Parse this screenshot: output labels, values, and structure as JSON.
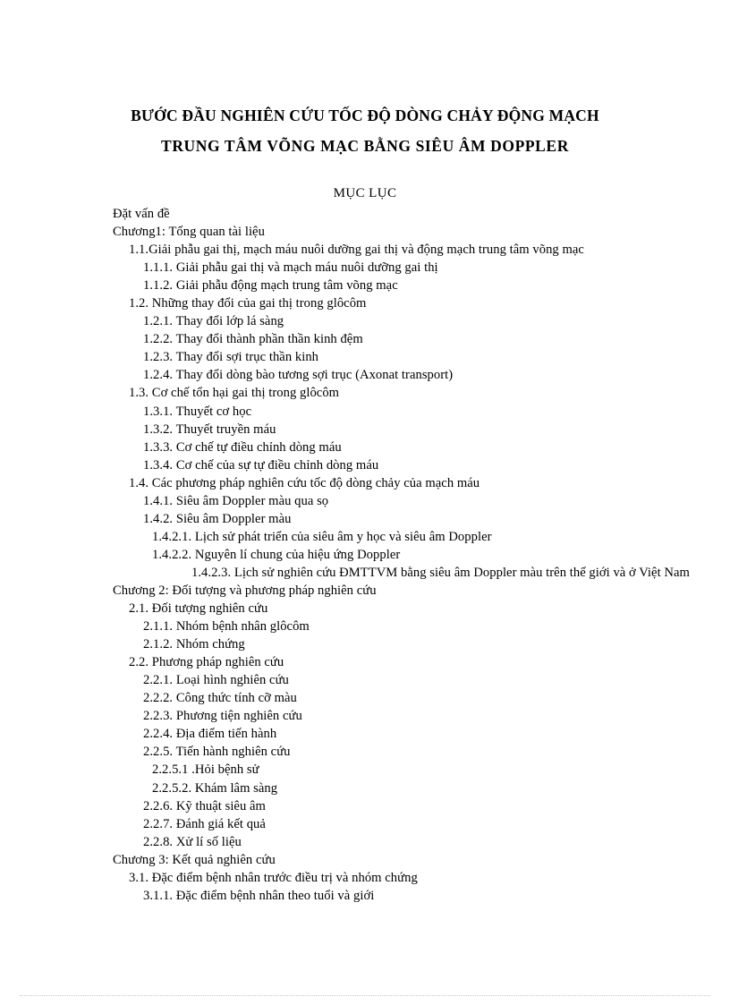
{
  "document": {
    "title_lines": [
      "BƯỚC ĐẦU NGHIÊN CỨU TỐC ĐỘ DÒNG CHẢY ĐỘNG MẠCH",
      "TRUNG TÂM  VÕNG MẠC BẰNG SIÊU ÂM  DOPPLER"
    ],
    "toc_heading": "MỤC LỤC",
    "toc_entries": [
      {
        "level": 0,
        "text": "Đặt vấn  đề"
      },
      {
        "level": 0,
        "text": "Chương1:  Tổng quan tài liệu"
      },
      {
        "level": 1,
        "text": "1.1.Giải  phẫu  gai thị,  mạch  máu  nuôi  dưỡng  gai thị  và động  mạch  trung  tâm võng  mạc"
      },
      {
        "level": 2,
        "text": "1.1.1. Giải  phẫu gai thị và mạch máu  nuôi  dưỡng gai thị"
      },
      {
        "level": 2,
        "text": "1.1.2. Giải  phẫu động mạch  trung tâm võng  mạc"
      },
      {
        "level": 1,
        "text": "1.2. Những  thay  đổi của gai thị  trong glôcôm"
      },
      {
        "level": 2,
        "text": "1.2.1. Thay  đổi lớp lá sàng"
      },
      {
        "level": 2,
        "text": "1.2.2. Thay  đổi thành  phần  thần  kinh  đệm"
      },
      {
        "level": 2,
        "text": "1.2.3. Thay  đổi sợi trục thần kinh"
      },
      {
        "level": 2,
        "text": "1.2.4. Thay  đổi dòng bào tương sợi  trục (Axonat  transport)"
      },
      {
        "level": 1,
        "text": "1.3. Cơ chế tổn hại  gai thị  trong  glôcôm"
      },
      {
        "level": 2,
        "text": "1.3.1. Thuyết  cơ học"
      },
      {
        "level": 2,
        "text": "1.3.2. Thuyết  truyền  máu"
      },
      {
        "level": 2,
        "text": "1.3.3. Cơ chế tự điều  chỉnh   dòng máu"
      },
      {
        "level": 2,
        "text": "1.3.4. Cơ chế của sự tự điều  chỉnh   dòng máu"
      },
      {
        "level": 1,
        "text": "1.4. Các phương  pháp nghiên   cứu tốc độ dòng  chảy  của mạch máu"
      },
      {
        "level": 2,
        "text": "1.4.1. Siêu  âm Doppler  màu qua sọ"
      },
      {
        "level": 2,
        "text": "1.4.2. Siêu  âm Doppler  màu"
      },
      {
        "level": 3,
        "text": "1.4.2.1. Lịch  sử phát triển  của siêu  âm y học và siêu  âm Doppler"
      },
      {
        "level": 3,
        "text": "1.4.2.2. Nguyên  lí chung  của hiệu  ứng Doppler"
      },
      {
        "level": 3,
        "wrap": true,
        "text": "1.4.2.3. Lịch  sử nghiên   cứu ĐMTTVM  bằng  siêu  âm Doppler  màu trên thế  giới  và ở Việt Nam"
      },
      {
        "level": 0,
        "text": "Chương 2:  Đối tượng và phương  pháp nghiên   cứu"
      },
      {
        "level": 1,
        "text": "2.1. Đối tượng nghiên   cứu"
      },
      {
        "level": 2,
        "text": "2.1.1. Nhóm bệnh nhân  glôcôm"
      },
      {
        "level": 2,
        "text": "2.1.2. Nhóm chứng"
      },
      {
        "level": 1,
        "text": "2.2. Phương  pháp nghiên   cứu"
      },
      {
        "level": 2,
        "text": "2.2.1. Loại hình  nghiên   cứu"
      },
      {
        "level": 2,
        "text": "2.2.2. Công thức tính  cỡ màu"
      },
      {
        "level": 2,
        "text": "2.2.3. Phương  tiện nghiên   cứu"
      },
      {
        "level": 2,
        "text": "2.2.4. Địa điểm  tiến  hành"
      },
      {
        "level": 2,
        "text": "2.2.5. Tiến  hành nghiên   cứu"
      },
      {
        "level": 3,
        "text": "2.2.5.1 .Hỏi bệnh sử"
      },
      {
        "level": 3,
        "text": "2.2.5.2. Khám lâm  sàng"
      },
      {
        "level": 2,
        "text": "2.2.6. Kỹ thuật  siêu  âm"
      },
      {
        "level": 2,
        "text": "2.2.7. Đánh  giá kết quả"
      },
      {
        "level": 2,
        "text": "2.2.8. Xử lí số liệu"
      },
      {
        "level": 0,
        "text": "Chương 3:  Kết quả nghiên   cứu"
      },
      {
        "level": 1,
        "text": "3.1. Đặc điểm  bệnh nhân  trước  điều  trị và nhóm  chứng"
      },
      {
        "level": 2,
        "text": "3.1.1. Đặc điểm  bệnh nhân  theo  tuổi  và giới"
      }
    ]
  }
}
